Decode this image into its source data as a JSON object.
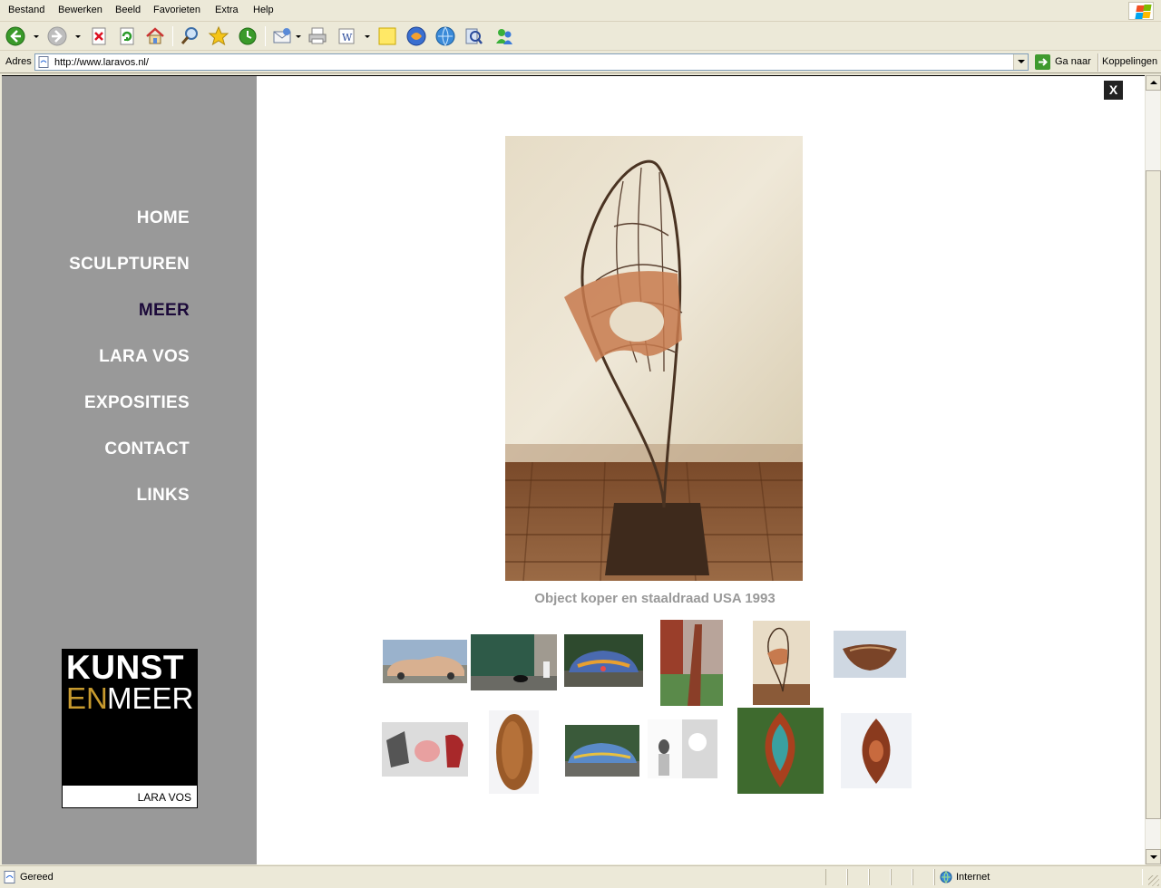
{
  "browser": {
    "menu": [
      {
        "label": "Bestand"
      },
      {
        "label": "Bewerken"
      },
      {
        "label": "Beeld"
      },
      {
        "label": "Favorieten"
      },
      {
        "label": "Extra"
      },
      {
        "label": "Help"
      }
    ],
    "address_label": "Adres",
    "url": "http://www.laravos.nl/",
    "go_label": "Ga naar",
    "links_label": "Koppelingen",
    "status_text": "Gereed",
    "zone_text": "Internet",
    "toolbar_icons": [
      "back-icon",
      "forward-icon",
      "stop-icon",
      "refresh-icon",
      "home-icon",
      "search-icon",
      "favorites-icon",
      "history-icon",
      "mail-icon",
      "print-icon",
      "edit-icon",
      "notes-icon",
      "messenger-icon",
      "globe-icon",
      "research-icon",
      "messenger-buddy-icon"
    ]
  },
  "site": {
    "nav": [
      {
        "label": "HOME",
        "active": false
      },
      {
        "label": "SCULPTUREN",
        "active": false
      },
      {
        "label": "MEER",
        "active": true
      },
      {
        "label": "LARA VOS",
        "active": false
      },
      {
        "label": "EXPOSITIES",
        "active": false
      },
      {
        "label": "CONTACT",
        "active": false
      },
      {
        "label": "LINKS",
        "active": false
      }
    ],
    "logo": {
      "line1": "KUNST",
      "en": "EN",
      "meer": "MEER",
      "footer": "LARA VOS"
    },
    "close_label": "X",
    "caption": "Object koper en staaldraad USA 1993",
    "colors": {
      "sidebar_bg": "#999999",
      "nav_text": "#ffffff",
      "nav_active": "#1c0a3a",
      "caption": "#999999",
      "logo_gold": "#c79a2e"
    }
  }
}
